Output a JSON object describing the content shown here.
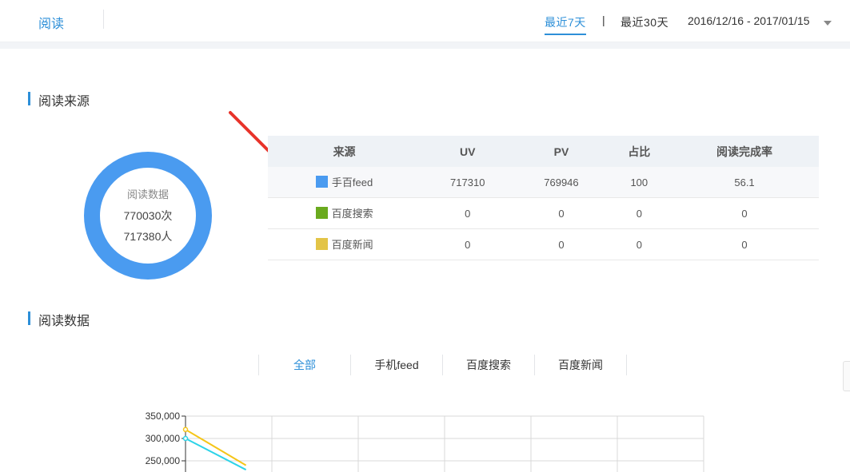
{
  "header": {
    "title": "阅读",
    "range_7": "最近7天",
    "separator": "|",
    "range_30": "最近30天",
    "date_range": "2016/12/16 - 2017/01/15"
  },
  "source_section": {
    "title": "阅读来源",
    "donut": {
      "label": "阅读数据",
      "count": "770030次",
      "users": "717380人",
      "color": "#4a9bf0"
    },
    "table": {
      "headers": [
        "来源",
        "UV",
        "PV",
        "占比",
        "阅读完成率"
      ],
      "rows": [
        {
          "source": "手百feed",
          "color": "#4a9bf0",
          "uv": "717310",
          "pv": "769946",
          "ratio": "100",
          "completion": "56.1"
        },
        {
          "source": "百度搜索",
          "color": "#6aaa1e",
          "uv": "0",
          "pv": "0",
          "ratio": "0",
          "completion": "0"
        },
        {
          "source": "百度新闻",
          "color": "#e3c447",
          "uv": "0",
          "pv": "0",
          "ratio": "0",
          "completion": "0"
        }
      ]
    }
  },
  "data_section": {
    "title": "阅读数据",
    "tabs": [
      "全部",
      "手机feed",
      "百度搜索",
      "百度新闻"
    ],
    "active_tab": 0
  },
  "chart_data": {
    "type": "line",
    "y_ticks": [
      "350,000",
      "300,000",
      "250,000"
    ],
    "series": [
      {
        "color": "#f5c518",
        "values": [
          320000,
          240000
        ]
      },
      {
        "color": "#2dd3e8",
        "values": [
          300000,
          230000
        ]
      }
    ],
    "grid": true
  }
}
